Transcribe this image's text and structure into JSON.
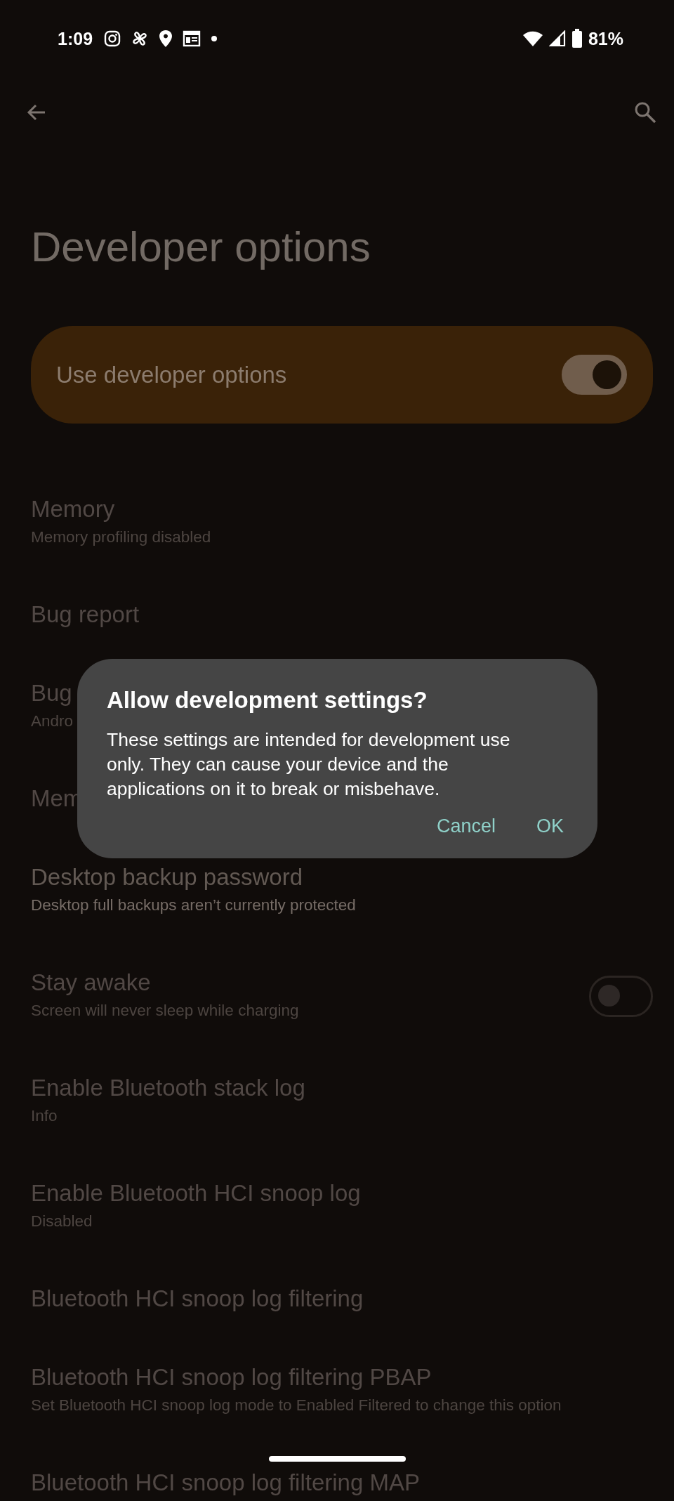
{
  "status_bar": {
    "time": "1:09",
    "battery": "81%"
  },
  "title": "Developer options",
  "main_switch": {
    "label": "Use developer options",
    "on": true
  },
  "items": [
    {
      "kind": "text",
      "title": "Memory",
      "subtitle": "Memory profiling disabled",
      "disabled": true
    },
    {
      "kind": "text",
      "title": "Bug report",
      "disabled": true
    },
    {
      "kind": "text",
      "title": "Bug",
      "subtitle": "Andro",
      "disabled": true
    },
    {
      "kind": "text",
      "title": "Mem",
      "disabled": true
    },
    {
      "kind": "text",
      "title": "Desktop backup password",
      "subtitle": "Desktop full backups aren’t currently protected",
      "disabled": false
    },
    {
      "kind": "switch",
      "title": "Stay awake",
      "subtitle": "Screen will never sleep while charging",
      "disabled": true,
      "on": false
    },
    {
      "kind": "text",
      "title": "Enable Bluetooth stack log",
      "subtitle": "Info",
      "disabled": true
    },
    {
      "kind": "text",
      "title": "Enable Bluetooth HCI snoop log",
      "subtitle": "Disabled",
      "disabled": true
    },
    {
      "kind": "text",
      "title": "Bluetooth HCI snoop log filtering",
      "disabled": true
    },
    {
      "kind": "text",
      "title": "Bluetooth HCI snoop log filtering PBAP",
      "subtitle": "Set Bluetooth HCI snoop log mode to Enabled Filtered to change this option",
      "disabled": true
    },
    {
      "kind": "text",
      "title": "Bluetooth HCI snoop log filtering MAP",
      "disabled": true
    }
  ],
  "dialog": {
    "title": "Allow development settings?",
    "message": "These settings are intended for development use only. They can cause your device and the applications on it to break or misbehave.",
    "buttons": [
      {
        "label": "Cancel"
      },
      {
        "label": "OK"
      }
    ]
  }
}
